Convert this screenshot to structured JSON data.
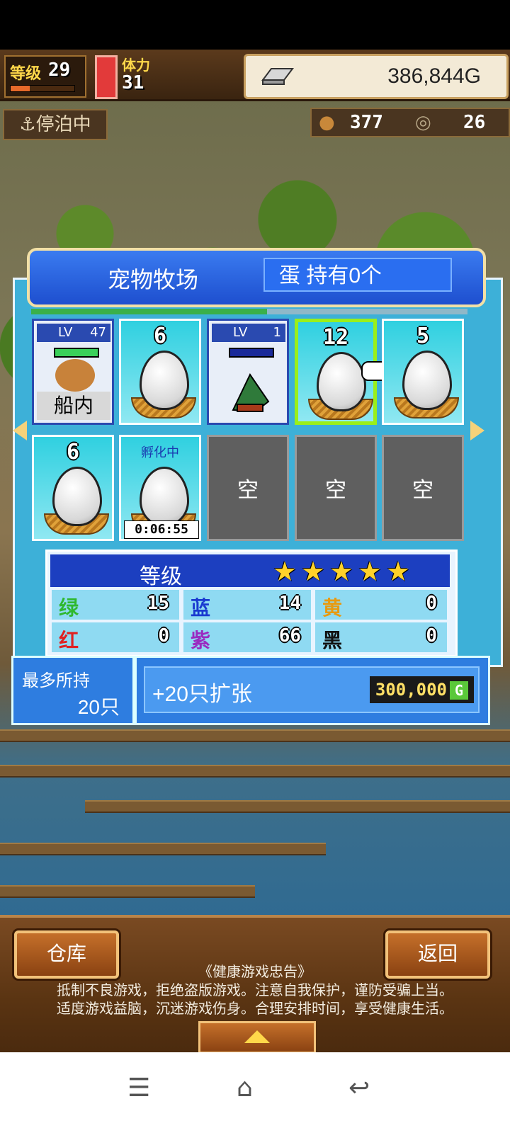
{
  "hud": {
    "level_label": "等级",
    "level": "29",
    "stamina_label": "体力",
    "stamina": "31",
    "money": "386,844G",
    "dock_status": "停泊中",
    "resource_1": "377",
    "resource_2": "26"
  },
  "panel": {
    "title": "宠物牧场",
    "egg_count": "蛋 持有0个",
    "progress": 0.54,
    "slots": [
      {
        "kind": "pet",
        "lv_label": "LV",
        "lv": "47",
        "location": "船内"
      },
      {
        "kind": "egg",
        "count": "6"
      },
      {
        "kind": "pet2",
        "lv_label": "LV",
        "lv": "1"
      },
      {
        "kind": "egg",
        "count": "12",
        "selected": true
      },
      {
        "kind": "egg",
        "count": "5"
      },
      {
        "kind": "egg",
        "count": "6"
      },
      {
        "kind": "hatching",
        "label": "孵化中",
        "timer": "0:06:55"
      },
      {
        "kind": "empty",
        "label": "空"
      },
      {
        "kind": "empty",
        "label": "空"
      },
      {
        "kind": "empty",
        "label": "空"
      }
    ]
  },
  "grades": {
    "label": "等级",
    "stars": 5,
    "stats": [
      {
        "name": "绿",
        "value": "15",
        "color": "#2fb82f"
      },
      {
        "name": "蓝",
        "value": "14",
        "color": "#1a3ad0"
      },
      {
        "name": "黄",
        "value": "0",
        "color": "#e89a10"
      },
      {
        "name": "红",
        "value": "0",
        "color": "#e02020"
      },
      {
        "name": "紫",
        "value": "66",
        "color": "#9a2ac0"
      },
      {
        "name": "黑",
        "value": "0",
        "color": "#111111"
      }
    ]
  },
  "capacity": {
    "label": "最多所持",
    "value": "20只",
    "expand_label": "+20只扩张",
    "price": "300,000",
    "price_unit": "G"
  },
  "bottom": {
    "left_button": "仓库",
    "right_button": "返回",
    "notice_title": "《健康游戏忠告》",
    "notice_line1": "抵制不良游戏，拒绝盗版游戏。注意自我保护，谨防受骗上当。",
    "notice_line2": "适度游戏益脑，沉迷游戏伤身。合理安排时间，享受健康生活。"
  },
  "colors": {
    "panel": "#3db0d8",
    "title_bar": "#1e4fcf",
    "selected_border": "#9aef1a"
  },
  "nav_icons": [
    "menu-icon",
    "home-icon",
    "back-icon"
  ]
}
